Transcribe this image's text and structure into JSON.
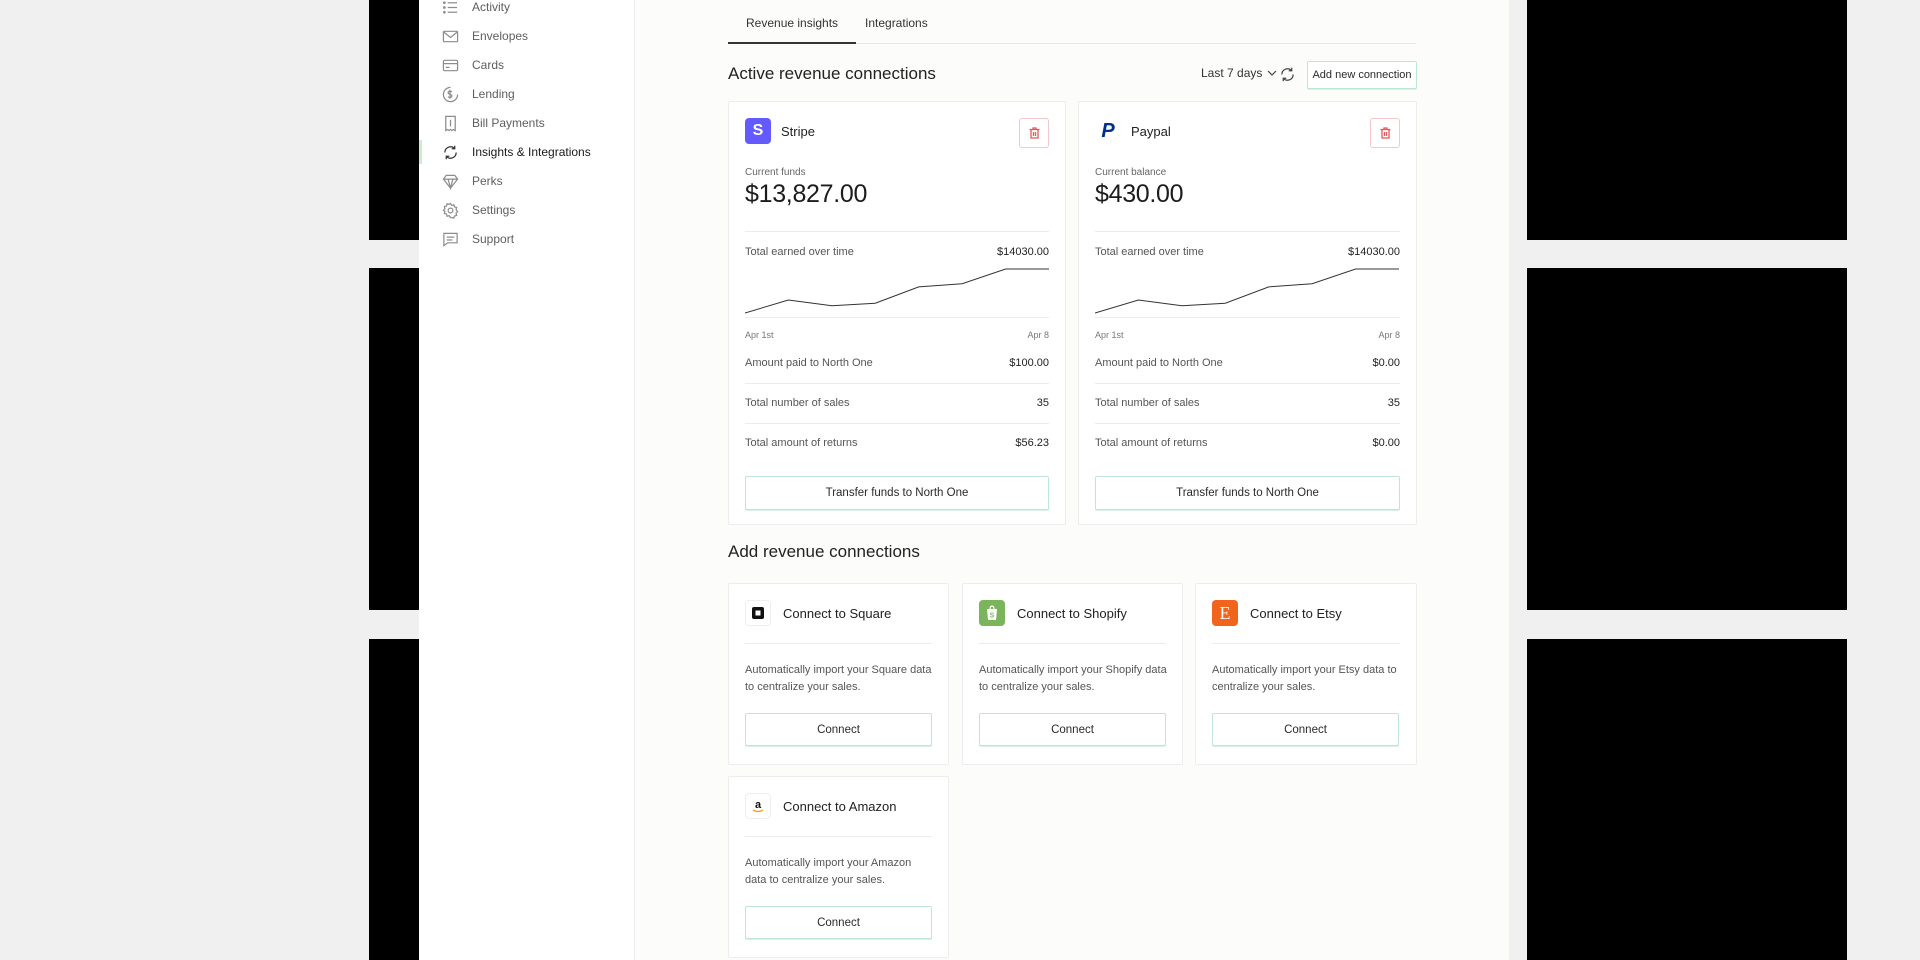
{
  "sidebar": {
    "items": [
      {
        "label": "Activity",
        "icon": "list-icon"
      },
      {
        "label": "Envelopes",
        "icon": "envelope-icon"
      },
      {
        "label": "Cards",
        "icon": "card-icon"
      },
      {
        "label": "Lending",
        "icon": "lending-icon"
      },
      {
        "label": "Bill Payments",
        "icon": "bill-icon"
      },
      {
        "label": "Insights & Integrations",
        "icon": "sync-icon",
        "active": true
      },
      {
        "label": "Perks",
        "icon": "diamond-icon"
      },
      {
        "label": "Settings",
        "icon": "gear-icon"
      },
      {
        "label": "Support",
        "icon": "chat-icon"
      }
    ]
  },
  "tabs": [
    {
      "label": "Revenue insights",
      "active": true
    },
    {
      "label": "Integrations",
      "active": false
    }
  ],
  "active_section": {
    "title": "Active revenue connections",
    "range_label": "Last 7 days",
    "add_button": "Add new connection"
  },
  "connections": [
    {
      "name": "Stripe",
      "brand_color": "#635bff",
      "logo_glyph": "S",
      "funds_label": "Current funds",
      "funds_value": "$13,827.00",
      "earned_label": "Total earned over time",
      "earned_value": "$14030.00",
      "date_start": "Apr 1st",
      "date_end": "Apr 8",
      "rows": [
        {
          "label": "Amount paid to North One",
          "value": "$100.00"
        },
        {
          "label": "Total number of sales",
          "value": "35"
        },
        {
          "label": "Total amount of returns",
          "value": "$56.23"
        }
      ],
      "transfer_label": "Transfer funds to North One"
    },
    {
      "name": "Paypal",
      "brand_color": "#003087",
      "logo_glyph": "P",
      "funds_label": "Current balance",
      "funds_value": "$430.00",
      "earned_label": "Total earned over time",
      "earned_value": "$14030.00",
      "date_start": "Apr 1st",
      "date_end": "Apr 8",
      "rows": [
        {
          "label": "Amount paid to North One",
          "value": "$0.00"
        },
        {
          "label": "Total number of sales",
          "value": "35"
        },
        {
          "label": "Total amount of returns",
          "value": "$0.00"
        }
      ],
      "transfer_label": "Transfer funds to North One"
    }
  ],
  "sparkline": [
    2,
    18,
    11,
    14,
    34,
    38,
    56,
    56
  ],
  "add_section": {
    "title": "Add revenue connections",
    "cards": [
      {
        "title": "Connect to Square",
        "desc": "Automatically import your Square data to centralize your sales.",
        "button": "Connect",
        "icon": "square-icon",
        "color": "#111111"
      },
      {
        "title": "Connect to Shopify",
        "desc": "Automatically import your Shopify data to centralize your sales.",
        "button": "Connect",
        "icon": "shopify-icon",
        "color": "#7ab55c"
      },
      {
        "title": "Connect to Etsy",
        "desc": "Automatically import your Etsy data to centralize your sales.",
        "button": "Connect",
        "icon": "etsy-icon",
        "color": "#f1641e"
      },
      {
        "title": "Connect to Amazon",
        "desc": "Automatically import your Amazon data to centralize your sales.",
        "button": "Connect",
        "icon": "amazon-icon",
        "color": "#ff9900"
      }
    ]
  }
}
